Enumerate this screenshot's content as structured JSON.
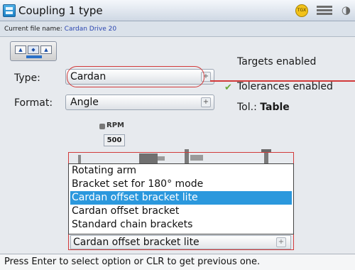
{
  "window": {
    "title": "Coupling 1 type"
  },
  "status_icons": {
    "badge": "TGX",
    "battery": "battery-icon",
    "signal": "signal-icon"
  },
  "file": {
    "label": "Current file name:",
    "value": "Cardan Drive 20"
  },
  "toolbar": {
    "btn_a": "▲",
    "btn_b": "◆",
    "btn_c": "▲"
  },
  "form": {
    "type_label": "Type:",
    "type_value": "Cardan",
    "format_label": "Format:",
    "format_value": "Angle"
  },
  "options": {
    "targets": "Targets enabled",
    "tolerances": "Tolerances enabled",
    "tol_label": "Tol.:",
    "tol_value": "Table"
  },
  "rpm": {
    "label": "RPM",
    "value": "500"
  },
  "dropdown": {
    "items": [
      "Rotating arm",
      "Bracket set for 180° mode",
      "Cardan offset bracket lite",
      "Cardan offset bracket",
      "Standard chain brackets"
    ],
    "selected_index": 2,
    "current": "Cardan offset bracket lite"
  },
  "statusbar": {
    "hint": "Press Enter to select option or CLR to get previous one."
  },
  "colors": {
    "accent": "#2b98dd",
    "highlight": "#d23a3a",
    "check": "#6aa83a"
  }
}
